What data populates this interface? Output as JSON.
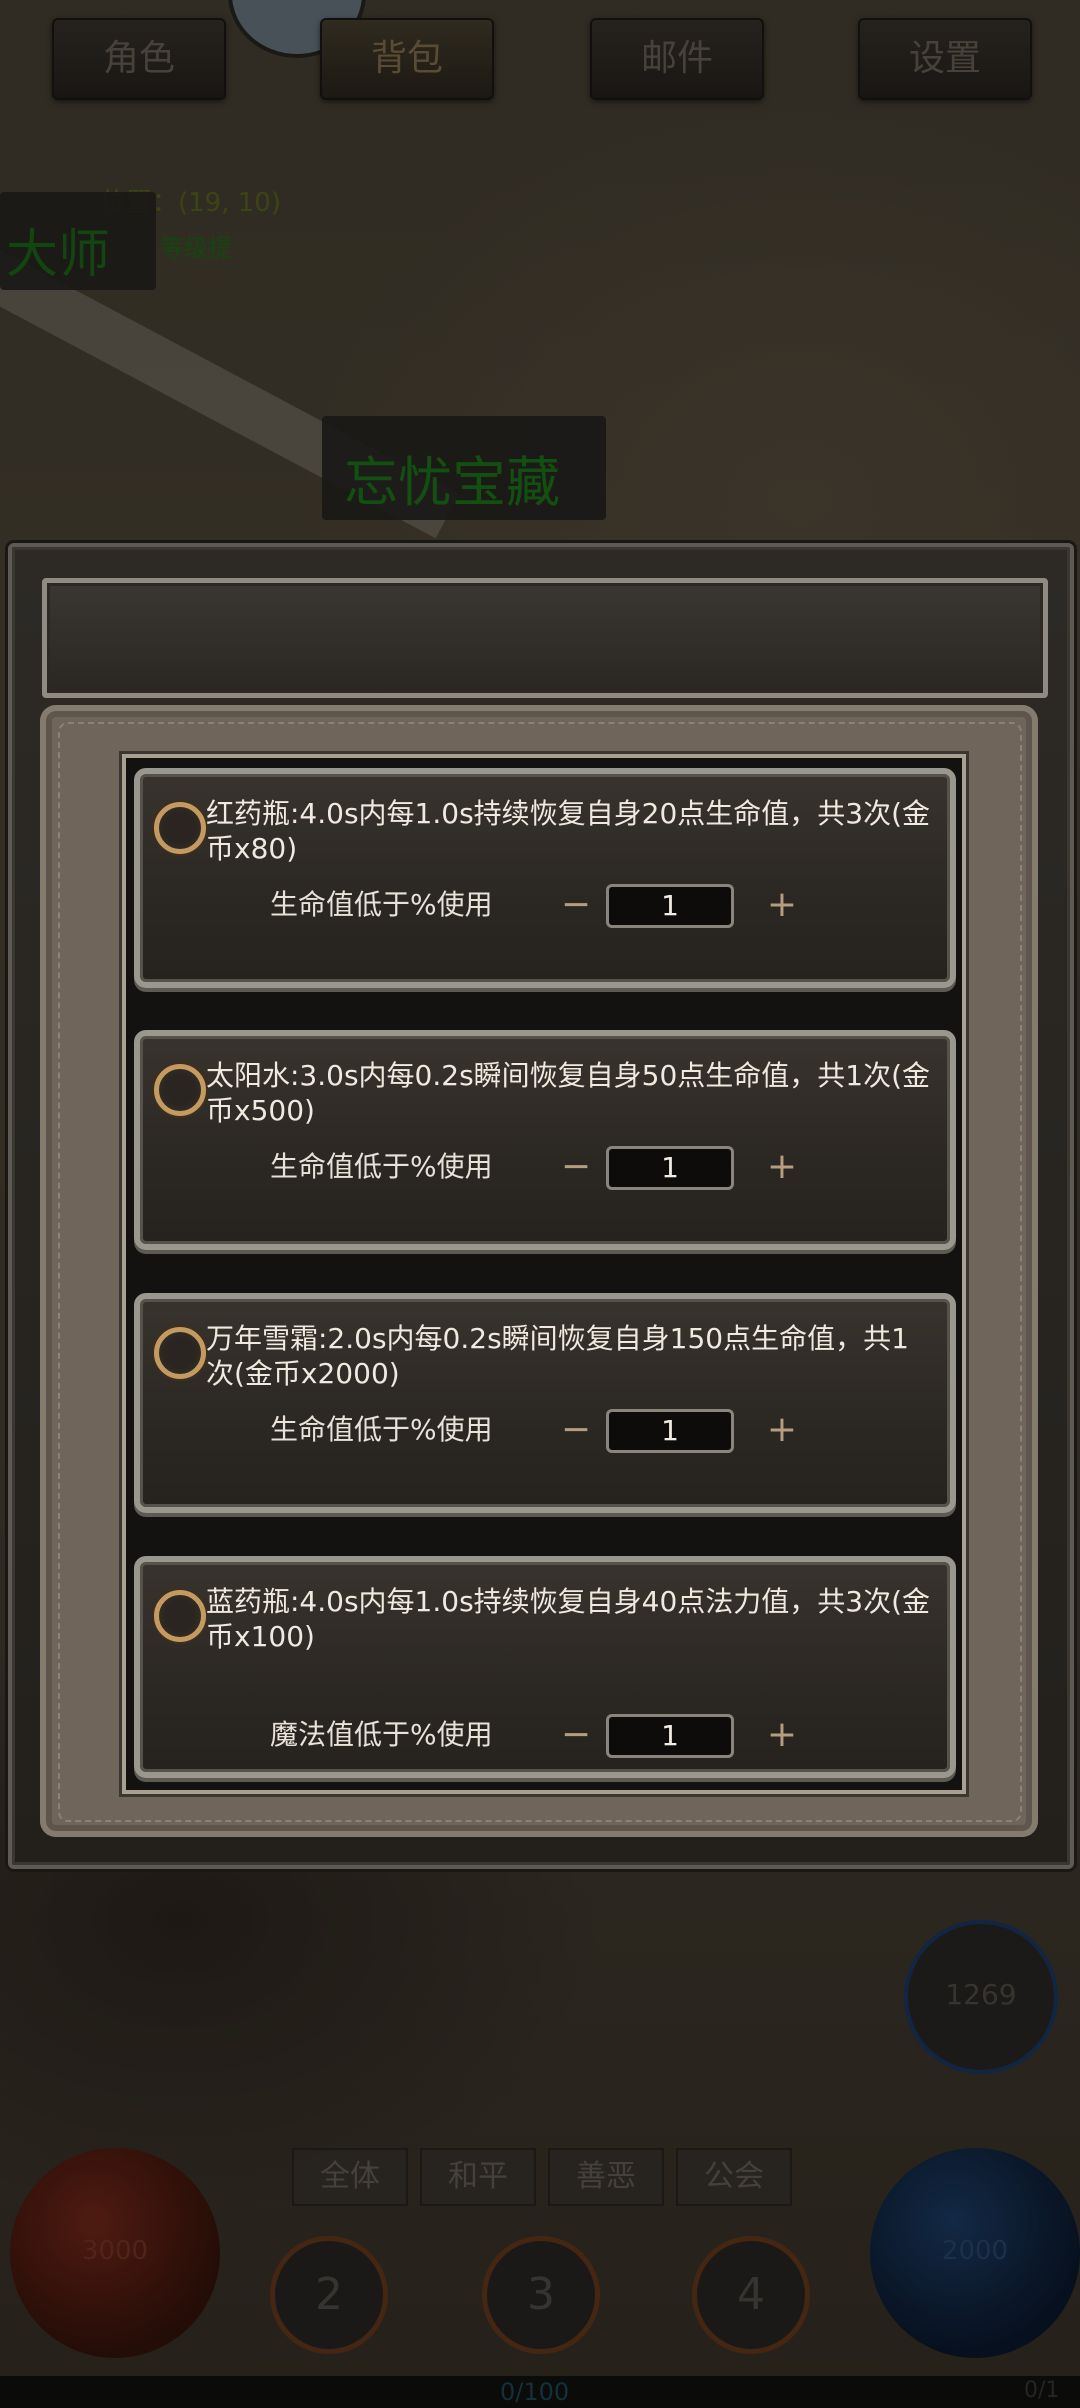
{
  "top_tabs": [
    "角色",
    "背包",
    "邮件",
    "设置"
  ],
  "background": {
    "coords": "位置：(19, 10)",
    "npc_title": "大师",
    "npc_subtitle": "等级提",
    "treasure_label": "忘忧宝藏",
    "skill_value": "1269"
  },
  "bottom_hud": {
    "chat_tabs": [
      "全体",
      "和平",
      "善恶",
      "公会"
    ],
    "hp_orb_value": "3000",
    "mp_orb_value": "2000",
    "slots": [
      "2",
      "3",
      "4"
    ],
    "exp_text": "0/100",
    "exp_right": "0/1"
  },
  "potions": [
    {
      "description": "红药瓶:4.0s内每1.0s持续恢复自身20点生命值，共3次(金币x80)",
      "threshold_label": "生命值低于%使用",
      "value": "1",
      "minus": "−",
      "plus": "+"
    },
    {
      "description": "太阳水:3.0s内每0.2s瞬间恢复自身50点生命值，共1次(金币x500)",
      "threshold_label": "生命值低于%使用",
      "value": "1",
      "minus": "−",
      "plus": "+"
    },
    {
      "description": "万年雪霜:2.0s内每0.2s瞬间恢复自身150点生命值，共1次(金币x2000)",
      "threshold_label": "生命值低于%使用",
      "value": "1",
      "minus": "−",
      "plus": "+"
    },
    {
      "description": "蓝药瓶:4.0s内每1.0s持续恢复自身40点法力值，共3次(金币x100)",
      "threshold_label": "魔法值低于%使用",
      "value": "1",
      "minus": "−",
      "plus": "+"
    }
  ]
}
